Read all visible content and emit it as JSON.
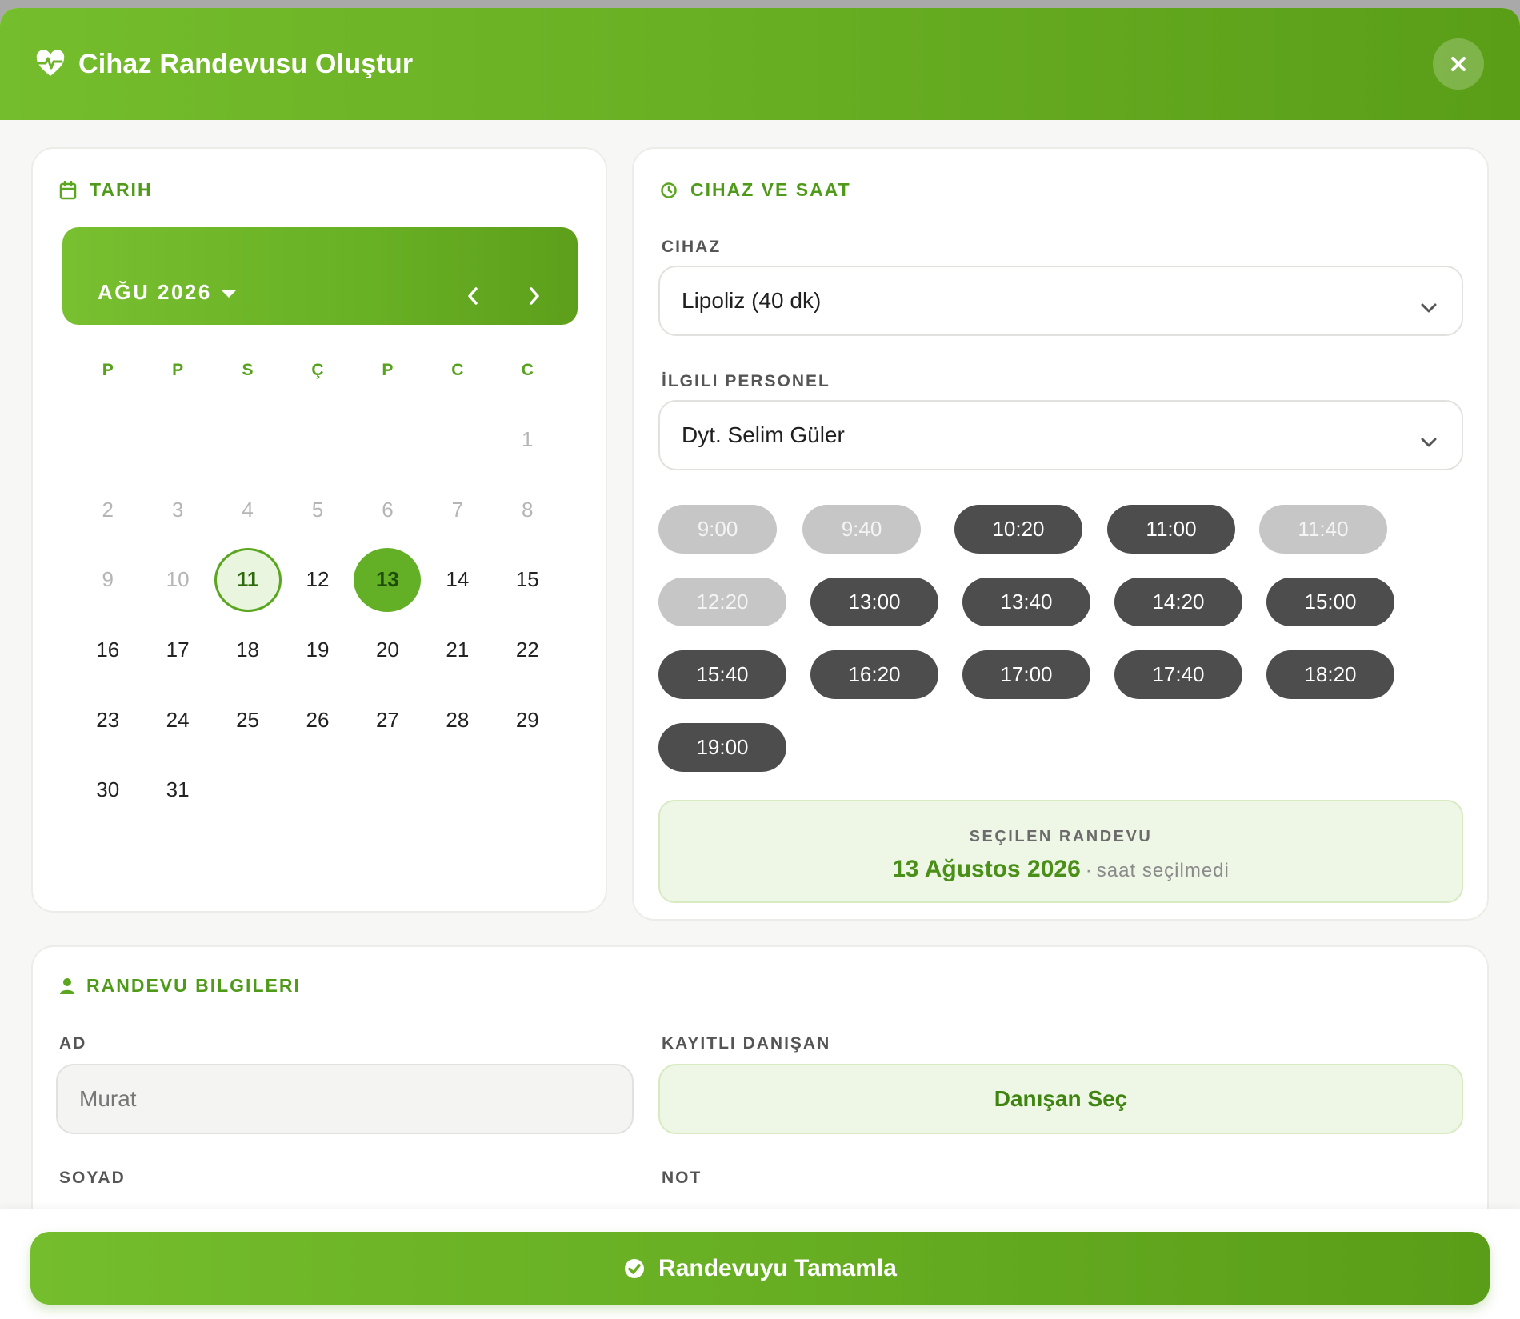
{
  "modal": {
    "title": "Cihaz Randevusu Oluştur",
    "header_icon": "heart-pulse-icon",
    "close_icon": "close-icon",
    "accent_color": "#6ab426"
  },
  "date_card": {
    "title": "TARIH",
    "icon": "calendar-icon",
    "month_label": "AĞU 2026",
    "weekdays": [
      "P",
      "P",
      "S",
      "Ç",
      "P",
      "C",
      "C"
    ],
    "days": [
      {
        "label": "",
        "state": "empty"
      },
      {
        "label": "",
        "state": "empty"
      },
      {
        "label": "",
        "state": "empty"
      },
      {
        "label": "",
        "state": "empty"
      },
      {
        "label": "",
        "state": "empty"
      },
      {
        "label": "",
        "state": "empty"
      },
      {
        "label": "1",
        "state": "muted"
      },
      {
        "label": "2",
        "state": "muted"
      },
      {
        "label": "3",
        "state": "muted"
      },
      {
        "label": "4",
        "state": "muted"
      },
      {
        "label": "5",
        "state": "muted"
      },
      {
        "label": "6",
        "state": "muted"
      },
      {
        "label": "7",
        "state": "muted"
      },
      {
        "label": "8",
        "state": "muted"
      },
      {
        "label": "9",
        "state": "muted"
      },
      {
        "label": "10",
        "state": "muted"
      },
      {
        "label": "11",
        "state": "today"
      },
      {
        "label": "12",
        "state": "normal"
      },
      {
        "label": "13",
        "state": "selected"
      },
      {
        "label": "14",
        "state": "normal"
      },
      {
        "label": "15",
        "state": "normal"
      },
      {
        "label": "16",
        "state": "normal"
      },
      {
        "label": "17",
        "state": "normal"
      },
      {
        "label": "18",
        "state": "normal"
      },
      {
        "label": "19",
        "state": "normal"
      },
      {
        "label": "20",
        "state": "normal"
      },
      {
        "label": "21",
        "state": "normal"
      },
      {
        "label": "22",
        "state": "normal"
      },
      {
        "label": "23",
        "state": "normal"
      },
      {
        "label": "24",
        "state": "normal"
      },
      {
        "label": "25",
        "state": "normal"
      },
      {
        "label": "26",
        "state": "normal"
      },
      {
        "label": "27",
        "state": "normal"
      },
      {
        "label": "28",
        "state": "normal"
      },
      {
        "label": "29",
        "state": "normal"
      },
      {
        "label": "30",
        "state": "normal"
      },
      {
        "label": "31",
        "state": "normal"
      }
    ]
  },
  "device_card": {
    "title": "CIHAZ VE SAAT",
    "icon": "clock-icon",
    "device_label": "CIHAZ",
    "device_value": "Lipoliz (40 dk)",
    "staff_label": "İLGILI PERSONEL",
    "staff_value": "Dyt. Selim Güler",
    "time_slots": [
      {
        "time": "9:00",
        "available": false
      },
      {
        "time": "9:40",
        "available": false
      },
      {
        "time": "10:20",
        "available": true
      },
      {
        "time": "11:00",
        "available": true
      },
      {
        "time": "11:40",
        "available": false
      },
      {
        "time": "12:20",
        "available": false
      },
      {
        "time": "13:00",
        "available": true
      },
      {
        "time": "13:40",
        "available": true
      },
      {
        "time": "14:20",
        "available": true
      },
      {
        "time": "15:00",
        "available": true
      },
      {
        "time": "15:40",
        "available": true
      },
      {
        "time": "16:20",
        "available": true
      },
      {
        "time": "17:00",
        "available": true
      },
      {
        "time": "17:40",
        "available": true
      },
      {
        "time": "18:20",
        "available": true
      },
      {
        "time": "19:00",
        "available": true
      }
    ],
    "summary_label": "SEÇILEN RANDEVU",
    "summary_date": "13 Ağustos 2026",
    "summary_separator": "·",
    "summary_hint": "saat seçilmedi"
  },
  "info_card": {
    "title": "RANDEVU BILGILERI",
    "icon": "user-icon",
    "first_name_label": "AD",
    "first_name_placeholder": "Murat",
    "registered_client_label": "KAYITLI DANIŞAN",
    "select_client_button": "Danışan Seç",
    "last_name_label": "SOYAD",
    "note_label": "NOT"
  },
  "footer": {
    "submit_label": "Randevuyu Tamamla",
    "submit_icon": "check-circle-icon"
  }
}
